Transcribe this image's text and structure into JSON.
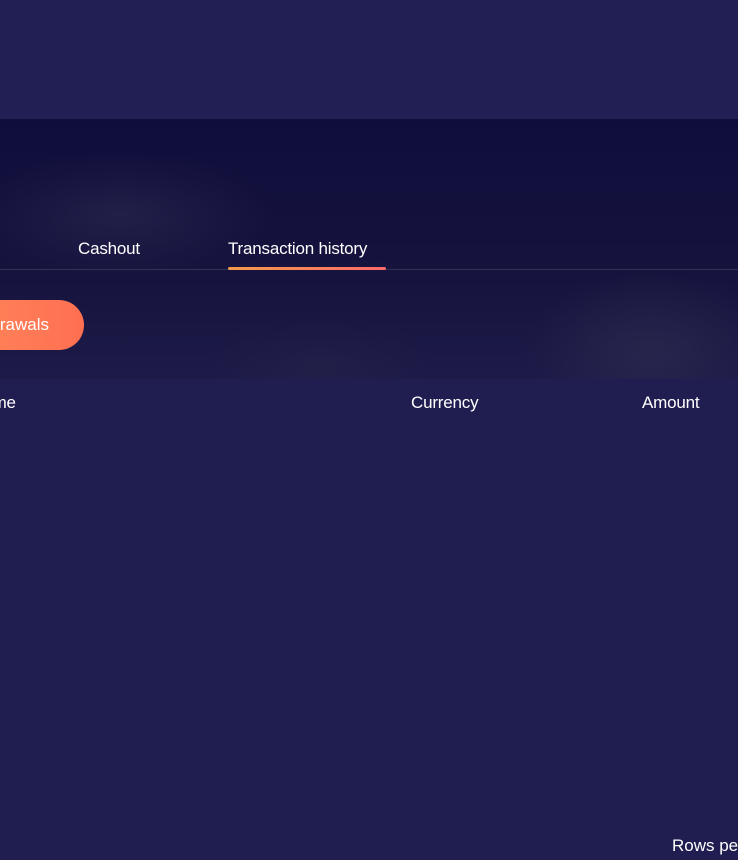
{
  "tabs": [
    {
      "label": "Cashout",
      "active": false
    },
    {
      "label": "Transaction history",
      "active": true
    }
  ],
  "filter": {
    "label": "Withdrawals",
    "visible_label": "rawals"
  },
  "table": {
    "columns": [
      "Date & time",
      "Currency",
      "Amount"
    ],
    "visible_columns": [
      "ime",
      "Currency",
      "Amount"
    ],
    "rows": []
  },
  "pagination": {
    "rows_per_page_label": "Rows pe"
  },
  "colors": {
    "background": "#201d50",
    "accent_start": "#ff8a5a",
    "accent_end": "#ff6f52"
  }
}
